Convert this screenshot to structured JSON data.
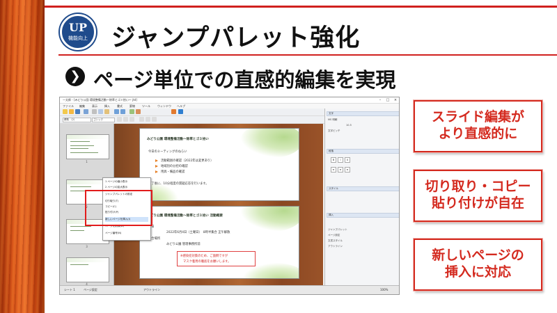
{
  "header": {
    "badge_main": "UP",
    "badge_sub": "機能向上",
    "headline": "ジャンプパレット強化",
    "arrow_glyph": "❯",
    "subheadline": "ページ単位での直感的編集を実現"
  },
  "colors": {
    "accent_red": "#d0201e",
    "badge_blue": "#1f4b8c",
    "callout_red": "#d42a1f"
  },
  "app": {
    "title": "一太郎 - [みどり公園 環境整備活動～除草とゴミ拾い～ jtd]",
    "menu": [
      "ファイル",
      "編集",
      "表示",
      "挿入",
      "書式",
      "罫線",
      "ツール",
      "ウィンドウ",
      "ヘルプ"
    ],
    "toolbar_font": "ゴシック",
    "toolbar_style": "標準 （2）",
    "thumb_numbers": [
      "1",
      "2",
      "3",
      "4"
    ],
    "context_menu": [
      "1 ページの縮小表示",
      "2 ページの拡大表示",
      "ジャンプパレットの設定",
      "切り取り(T)",
      "コピー(C)",
      "貼り付け(P)",
      "新しいページを挿入(I)",
      "ページを削除(D)",
      "ページ番号(N)"
    ],
    "slide1": {
      "title": "みどり公園 環境整備活動～除草とゴミ拾い",
      "subtitle": "今日のミーティングのねらい",
      "bullets": [
        "活動範囲の確認（2022年は変更あり）",
        "地域別の分担の確認",
        "用具・備品の確認"
      ],
      "closing": "終了後に、10分程度の質疑応答を行います。"
    },
    "slide2": {
      "title": "みどり公園 環境整備活動～除草とゴミ拾い 活動概要",
      "date_label": "期日",
      "date_value": "2022年6月4日（土曜日）　8時半集合 正午解散",
      "place_label": "集合場所",
      "place_value": "みどり公園 管理事務所前",
      "notice_1": "※感染症対策のため、ご面倒ですが",
      "notice_2": "マスク着用の徹底をお願いします。"
    },
    "props": {
      "sec_font": "文字",
      "sec_para": "段落",
      "sec_style": "スタイル",
      "sec_insert": "挿入",
      "font_name": "MS 明朝",
      "font_size": "10.5",
      "pitch_label": "文字ピッチ",
      "items": [
        "ジャンプパレット",
        "ページ設定",
        "文書スタイル",
        "アウトライン"
      ]
    },
    "tabs": [
      "シート 1",
      "ページ設定",
      "アウトライン"
    ],
    "zoom": "100%"
  },
  "callouts": [
    {
      "line1": "スライド編集が",
      "line2": "より直感的に"
    },
    {
      "line1": "切り取り・コピー",
      "line2": "貼り付けが自在"
    },
    {
      "line1": "新しいページの",
      "line2": "挿入に対応"
    }
  ]
}
